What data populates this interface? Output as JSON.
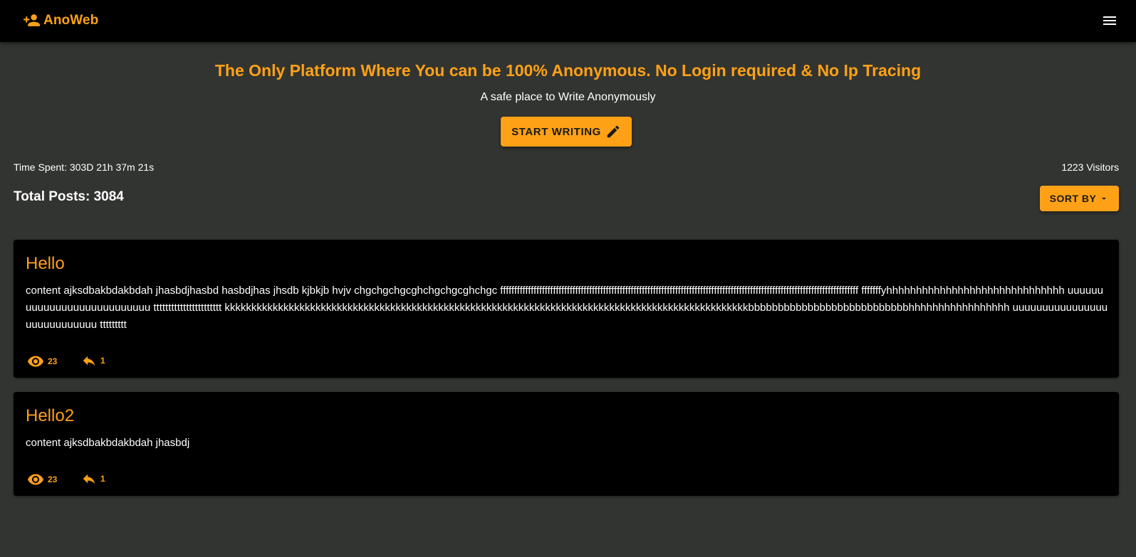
{
  "header": {
    "brand": "AnoWeb",
    "brand_icon": "person-add-icon",
    "menu_icon": "hamburger-menu-icon"
  },
  "hero": {
    "title": "The Only Platform Where You can be 100% Anonymous. No Login required & No Ip Tracing",
    "subtitle": "A safe place to Write Anonymously",
    "cta_label": "START WRITING",
    "cta_icon": "pencil-icon"
  },
  "stats": {
    "time_spent": "Time Spent: 303D 21h 37m 21s",
    "visitors": "1223 Visitors",
    "total_posts": "Total Posts: 3084"
  },
  "sort": {
    "label": "SORT BY",
    "icon": "caret-down-icon"
  },
  "posts": [
    {
      "title": "Hello",
      "content": "content ajksdbakbdakbdah jhasbdjhasbd hasbdjhas jhsdb kjbkjb hvjv chgchgchgcghchgchgcghchgc fffffffffffffffffffffffffffffffffffffffffffffffffffffffffffffffffffffffffffffffffffffffffffffffffffffffffffffffffffffffffffffffff fffffffyhhhhhhhhhhhhhhhhhhhhhhhhhhhhhh uuuuuuuuuuuuuuuuuuuuuuuuuuu ttttttttttttttttttttttt kkkkkkkkkkkkkkkkkkkkkkkkkkkkkkkkkkkkkkkkkkkkkkkkkkkkkkkkkkkkkkkkkkkkkkkkkkkkkkkkkkkkkkkkkkkkkkkkkkbbbbbbbbbbbbbbbbbbbbbbbbbbbhhhhhhhhhhhhhhhhh uuuuuuuuuuuuuuuuuuuuuuuuuuuu ttttttttt",
      "views": "23",
      "replies": "1"
    },
    {
      "title": "Hello2",
      "content": "content ajksdbakbdakbdah jhasbdj",
      "views": "23",
      "replies": "1"
    }
  ],
  "colors": {
    "accent": "#ffa116",
    "background": "#323431",
    "navbar": "#000000",
    "card": "#000000"
  }
}
